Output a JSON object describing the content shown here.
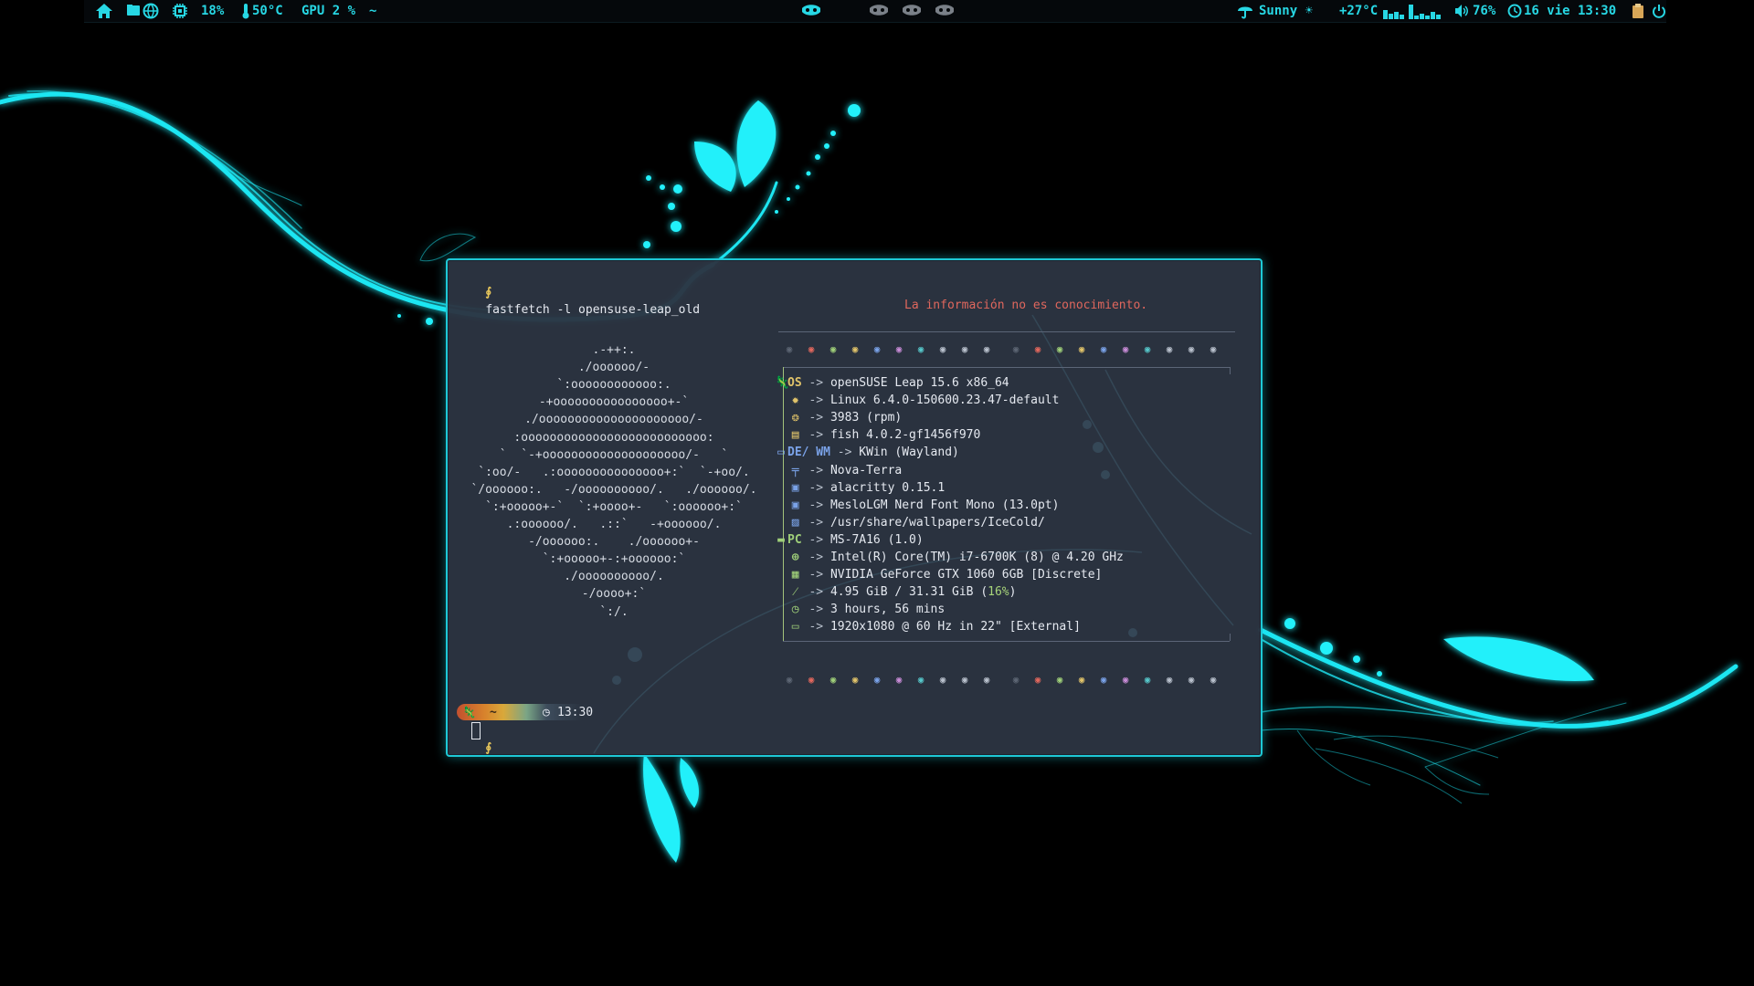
{
  "panel": {
    "cpu_percent": "18%",
    "temp": "50°C",
    "gpu": "GPU 2 %",
    "tilde": "~",
    "weather_text": "Sunny ☀",
    "outside_temp": "+27°C",
    "volume": "76%",
    "clock": "16 vie 13:30",
    "accent_color": "#27d7e4"
  },
  "terminal": {
    "prompt_glyph": "∮",
    "command": "fastfetch -l opensuse-leap_old",
    "quote": "La información no es conocimiento.",
    "ascii_logo": [
      ".-++:.",
      "./oooooo/-",
      "`:oooooooooooo:.",
      "-+oooooooooooooooo+-`",
      "./ooooooooooooooooooooo/-",
      ":oooooooooooooooooooooooooo:",
      "`  `-+oooooooooooooooooooo/-   `",
      "`:oo/-   .:ooooooooooooooo+:`  `-+oo/.",
      "`/oooooo:.   -/oooooooooo/.   ./oooooo/.",
      "`:+ooooo+-`  `:+oooo+-   `:oooooo+:`",
      ".:oooooo/.   .::`   -+oooooo/.",
      "-/oooooo:.    ./oooooo+-",
      "`:+ooooo+-:+oooooo:`",
      "./oooooooooo/.",
      "-/oooo+:`",
      "`:/."
    ],
    "info_sections": [
      {
        "key": "OS",
        "icon": "chameleon-icon",
        "rows": [
          {
            "icon": "",
            "text": "openSUSE Leap 15.6 x86_64"
          },
          {
            "icon": "gear-icon",
            "text": "Linux 6.4.0-150600.23.47-default"
          },
          {
            "icon": "package-icon",
            "text": "3983 (rpm)"
          },
          {
            "icon": "terminal-icon",
            "text": "fish 4.0.2-gf1456f970"
          }
        ]
      },
      {
        "key": "DE/ WM",
        "icon": "window-icon",
        "rows": [
          {
            "icon": "",
            "text": "KWin (Wayland)"
          },
          {
            "icon": "paintbrush-icon",
            "text": "Nova-Terra"
          },
          {
            "icon": "terminal-window-icon",
            "text": "alacritty 0.15.1"
          },
          {
            "icon": "font-icon",
            "text": "MesloLGM Nerd Font Mono (13.0pt)"
          },
          {
            "icon": "image-icon",
            "text": "/usr/share/wallpapers/IceCold/"
          }
        ]
      },
      {
        "key": "PC",
        "icon": "laptop-icon",
        "rows": [
          {
            "icon": "",
            "text": "MS-7A16 (1.0)"
          },
          {
            "icon": "cpu-icon",
            "text": "Intel(R) Core(TM) i7-6700K (8) @ 4.20 GHz"
          },
          {
            "icon": "gpu-icon",
            "text": "NVIDIA GeForce GTX 1060 6GB [Discrete]"
          },
          {
            "icon": "memory-icon",
            "text": "4.95 GiB / 31.31 GiB (",
            "pct": "16%",
            "tail": ")"
          },
          {
            "icon": "clock-icon",
            "text": "3 hours, 56 mins"
          },
          {
            "icon": "monitor-icon",
            "text": "1920x1080 @ 60 Hz in 22\" [External]"
          }
        ]
      }
    ],
    "arrow": "->",
    "dot_colors": [
      "#5c6573",
      "#e0675d",
      "#9fcf79",
      "#e0c36a",
      "#7aa2e8",
      "#c78bd6",
      "#56c6c9",
      "#b8c0cc",
      "#b8c0cc",
      "#b8c0cc"
    ],
    "prompt_segment_tilde": "~",
    "prompt_time": "13:30"
  }
}
